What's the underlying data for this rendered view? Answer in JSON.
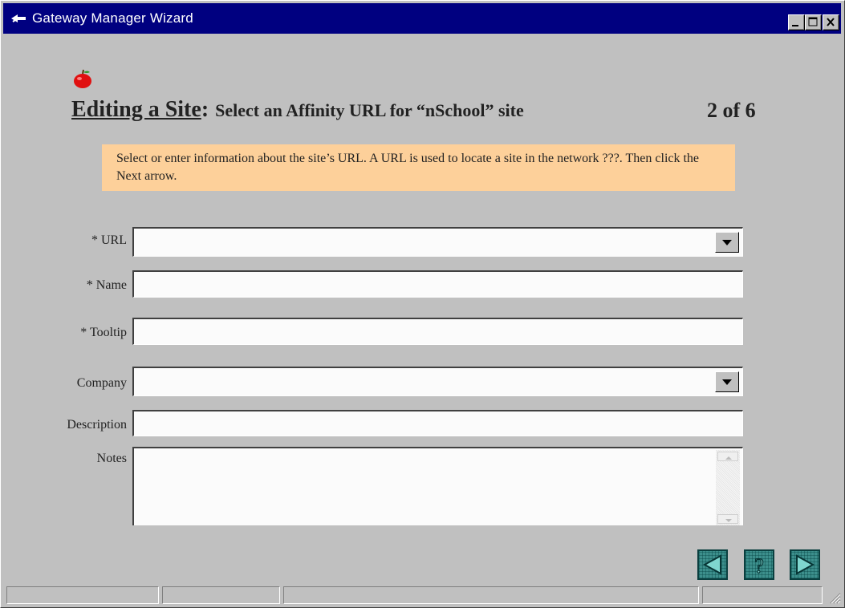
{
  "window": {
    "title": "Gateway Manager Wizard"
  },
  "heading": {
    "title": "Editing a Site",
    "colon": ":",
    "subtitle": "Select an Affinity URL for “nSchool” site",
    "step": "2 of 6"
  },
  "info": {
    "text": "Select or enter information about the site’s URL. A URL is used to locate a site in the network ???. Then click the Next arrow."
  },
  "form": {
    "url_label": "* URL",
    "url_value": "",
    "name_label": "* Name",
    "name_value": "",
    "tooltip_label": "* Tooltip",
    "tooltip_value": "",
    "company_label": "Company",
    "company_value": "",
    "description_label": "Description",
    "description_value": "",
    "notes_label": "Notes",
    "notes_value": ""
  },
  "nav": {
    "back_icon": "left-arrow-icon",
    "help_icon": "question-mark-icon",
    "next_icon": "right-arrow-icon"
  },
  "colors": {
    "titlebar": "#000080",
    "info_bg": "#fdd09a",
    "nav_button": "#3c8f8c"
  }
}
